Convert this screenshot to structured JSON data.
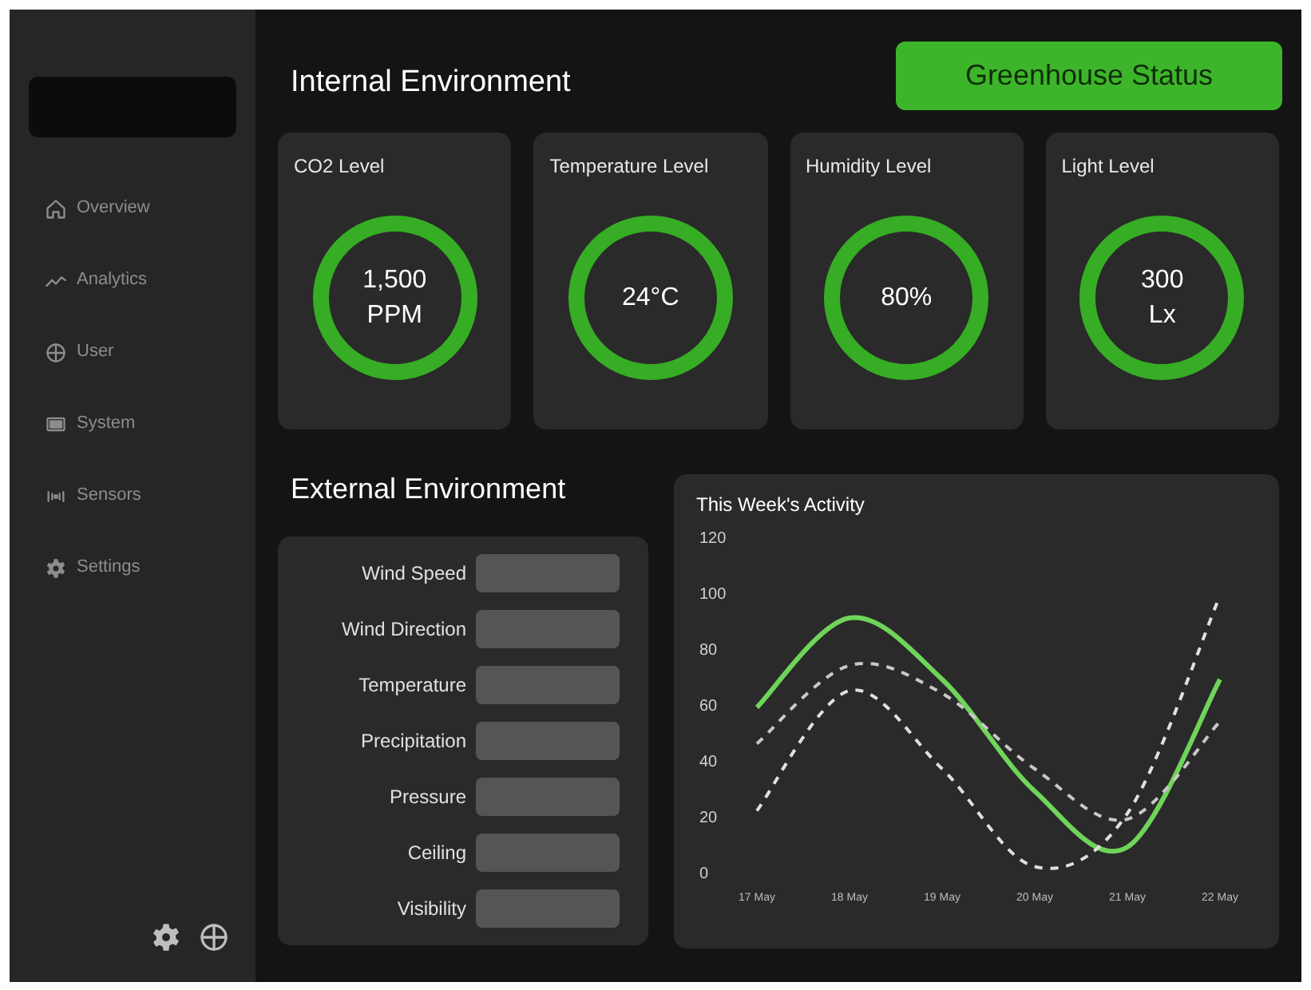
{
  "sidebar": {
    "items": [
      {
        "label": "Overview"
      },
      {
        "label": "Analytics"
      },
      {
        "label": "User"
      },
      {
        "label": "System"
      },
      {
        "label": "Sensors"
      },
      {
        "label": "Settings"
      }
    ]
  },
  "internal": {
    "title": "Internal Environment",
    "cards": [
      {
        "label": "CO2 Level",
        "value": "1,500",
        "unit": "PPM"
      },
      {
        "label": "Temperature Level",
        "value": "24°C"
      },
      {
        "label": "Humidity Level",
        "value": "80%"
      },
      {
        "label": "Light Level",
        "value": "300",
        "unit": "Lx"
      }
    ]
  },
  "status_button": "Greenhouse Status",
  "external": {
    "title": "External Environment",
    "fields": [
      "Wind Speed",
      "Wind Direction",
      "Temperature",
      "Precipitation",
      "Pressure",
      "Ceiling",
      "Visibility"
    ]
  },
  "activity": {
    "chart_data": {
      "type": "line",
      "title": "This Week's Activity",
      "categories": [
        "17 May",
        "18 May",
        "19 May",
        "20 May",
        "21 May",
        "22 May"
      ],
      "ylim": [
        0,
        120
      ],
      "yticks": [
        0,
        20,
        40,
        60,
        80,
        100,
        120
      ],
      "series": [
        {
          "color": "#6fd45a",
          "line_style": "solid",
          "values": [
            60,
            92,
            70,
            30,
            10,
            70
          ]
        },
        {
          "color": "#c8c8c8",
          "line_style": "dashed",
          "values": [
            47,
            75,
            65,
            38,
            20,
            55
          ]
        },
        {
          "color": "#e0e0e0",
          "line_style": "dashed",
          "values": [
            23,
            66,
            38,
            3,
            22,
            100
          ]
        }
      ]
    }
  }
}
